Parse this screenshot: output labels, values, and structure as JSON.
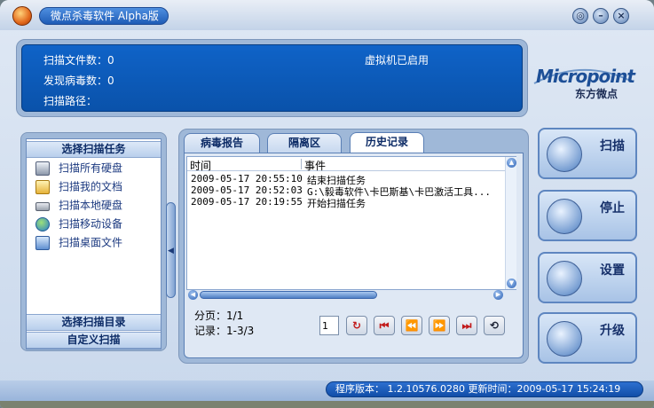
{
  "window": {
    "title": "微点杀毒软件 Alpha版"
  },
  "header": {
    "scanned_files_label": "扫描文件数：0",
    "found_virus_label": "发现病毒数：0",
    "scan_path_label": "扫描路径：",
    "vm_status": "虚拟机已启用"
  },
  "logo": {
    "main": "Micropoint",
    "sub": "东方微点"
  },
  "sidebar": {
    "task_header": "选择扫描任务",
    "tasks": [
      {
        "label": "扫描所有硬盘",
        "icon": "pc-icon"
      },
      {
        "label": "扫描我的文档",
        "icon": "folder-icon"
      },
      {
        "label": "扫描本地硬盘",
        "icon": "hard-disk-icon"
      },
      {
        "label": "扫描移动设备",
        "icon": "globe-icon"
      },
      {
        "label": "扫描桌面文件",
        "icon": "desktop-icon"
      }
    ],
    "dir_header": "选择扫描目录",
    "custom_header": "自定义扫描"
  },
  "tabs": [
    {
      "label": "病毒报告",
      "active": false
    },
    {
      "label": "隔离区",
      "active": false
    },
    {
      "label": "历史记录",
      "active": true
    }
  ],
  "history": {
    "columns": [
      "时间",
      "事件"
    ],
    "rows": [
      {
        "time": "2009-05-17 20:55:10",
        "event": "结束扫描任务"
      },
      {
        "time": "2009-05-17 20:52:03",
        "event": "G:\\毅毒软件\\卡巴斯基\\卡巴激活工具..."
      },
      {
        "time": "2009-05-17 20:19:55",
        "event": "开始扫描任务"
      }
    ]
  },
  "pager": {
    "page_label": "分页：1/1",
    "records_label": "记录：1-3/3",
    "page_value": "1"
  },
  "actions": {
    "scan": "扫描",
    "stop": "停止",
    "settings": "设置",
    "upgrade": "升级"
  },
  "status": {
    "text": "程序版本： 1.2.10576.0280  更新时间：2009-05-17 15:24:19"
  },
  "colors": {
    "header_blue": "#0f63c8",
    "accent_red": "#c21a1a"
  }
}
